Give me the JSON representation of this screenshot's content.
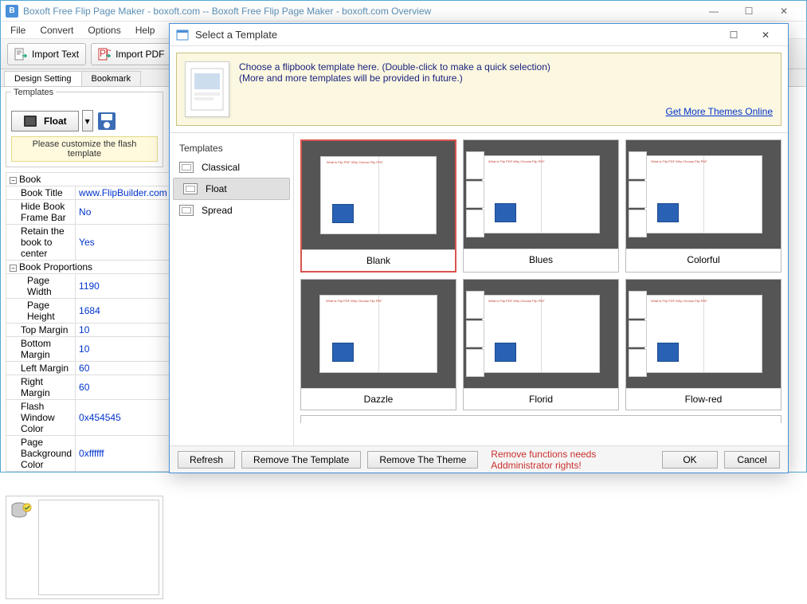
{
  "main": {
    "title": "Boxoft Free Flip Page Maker - boxoft.com -- Boxoft Free Flip Page Maker - boxoft.com Overview",
    "menu": [
      "File",
      "Convert",
      "Options",
      "Help"
    ],
    "toolbar": {
      "import_text": "Import Text",
      "import_pdf": "Import PDF"
    },
    "tabs": {
      "design": "Design Setting",
      "bookmark": "Bookmark"
    },
    "templates_legend": "Templates",
    "template_name": "Float",
    "customize_msg": "Please customize the flash template",
    "props": {
      "group_book": "Book",
      "rows": [
        {
          "k": "Book Title",
          "v": "www.FlipBuilder.com"
        },
        {
          "k": "Hide Book Frame Bar",
          "v": "No"
        },
        {
          "k": "Retain the book to center",
          "v": "Yes"
        }
      ],
      "group_prop": "Book Proportions",
      "rows2": [
        {
          "k": "Page Width",
          "v": "1190"
        },
        {
          "k": "Page Height",
          "v": "1684"
        },
        {
          "k": "Top Margin",
          "v": "10"
        },
        {
          "k": "Bottom Margin",
          "v": "10"
        },
        {
          "k": "Left Margin",
          "v": "60"
        },
        {
          "k": "Right Margin",
          "v": "60"
        },
        {
          "k": "Flash Window Color",
          "v": "0x454545"
        },
        {
          "k": "Page Background Color",
          "v": "0xffffff"
        }
      ]
    }
  },
  "dialog": {
    "title": "Select a Template",
    "info1": "Choose a flipbook template here. (Double-click to make a quick selection)",
    "info2": "(More and more templates will be provided in future.)",
    "link": "Get More Themes Online",
    "sidebar_head": "Templates",
    "sidebar": [
      {
        "label": "Classical"
      },
      {
        "label": "Float"
      },
      {
        "label": "Spread"
      }
    ],
    "templates": [
      {
        "label": "Blank",
        "cls": "tmpl-blank",
        "selected": true,
        "strip": false
      },
      {
        "label": "Blues",
        "cls": "tmpl-blues",
        "selected": false,
        "strip": true
      },
      {
        "label": "Colorful",
        "cls": "tmpl-colorful",
        "selected": false,
        "strip": true
      },
      {
        "label": "Dazzle",
        "cls": "tmpl-dazzle",
        "selected": false,
        "strip": false
      },
      {
        "label": "Florid",
        "cls": "tmpl-florid",
        "selected": false,
        "strip": true
      },
      {
        "label": "Flow-red",
        "cls": "tmpl-flowred",
        "selected": false,
        "strip": true
      }
    ],
    "footer": {
      "refresh": "Refresh",
      "remove_tpl": "Remove The Template",
      "remove_theme": "Remove The Theme",
      "admin": "Remove functions needs Addministrator rights!",
      "ok": "OK",
      "cancel": "Cancel"
    }
  }
}
